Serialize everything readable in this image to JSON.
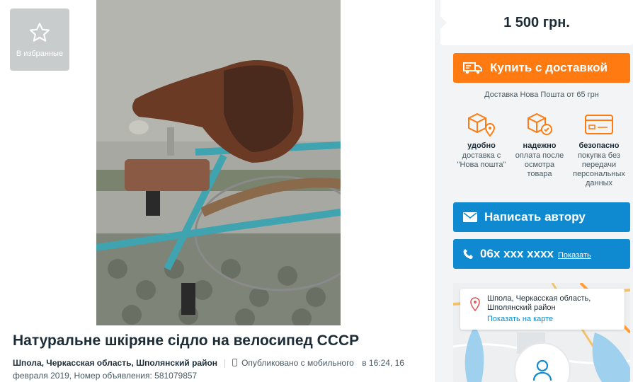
{
  "favorite": {
    "label": "В избранные",
    "icon": "star-icon"
  },
  "listing": {
    "title": "Натуральне шкіряне сідло на велосипед СССР",
    "location": "Шпола, Черкасская область, Шполянский район",
    "published": "Опубликовано с мобильного",
    "date_line_1": "в 16:24, 16",
    "date_line_2": "февраля 2019, Номер объявления: 581079857"
  },
  "sidebar": {
    "price": "1 500 грн.",
    "buy_button": "Купить с доставкой",
    "delivery_note": "Доставка Нова Пошта от 65 грн",
    "features": [
      {
        "icon": "box-pin-icon",
        "title": "удобно",
        "desc": "доставка с \"Нова пошта\""
      },
      {
        "icon": "box-check-icon",
        "title": "надежно",
        "desc": "оплата после осмотра товара"
      },
      {
        "icon": "card-icon",
        "title": "безопасно",
        "desc": "покупка без передачи персональных данных"
      }
    ],
    "write_button": "Написать автору",
    "phone": "06x xxx xxxx",
    "show_label": "Показать",
    "map": {
      "address": "Шпола, Черкасская область, Шполянский район",
      "show_on_map": "Показать на карте"
    }
  },
  "colors": {
    "accent_orange": "#ff7a11",
    "accent_blue": "#0f8ad0"
  }
}
